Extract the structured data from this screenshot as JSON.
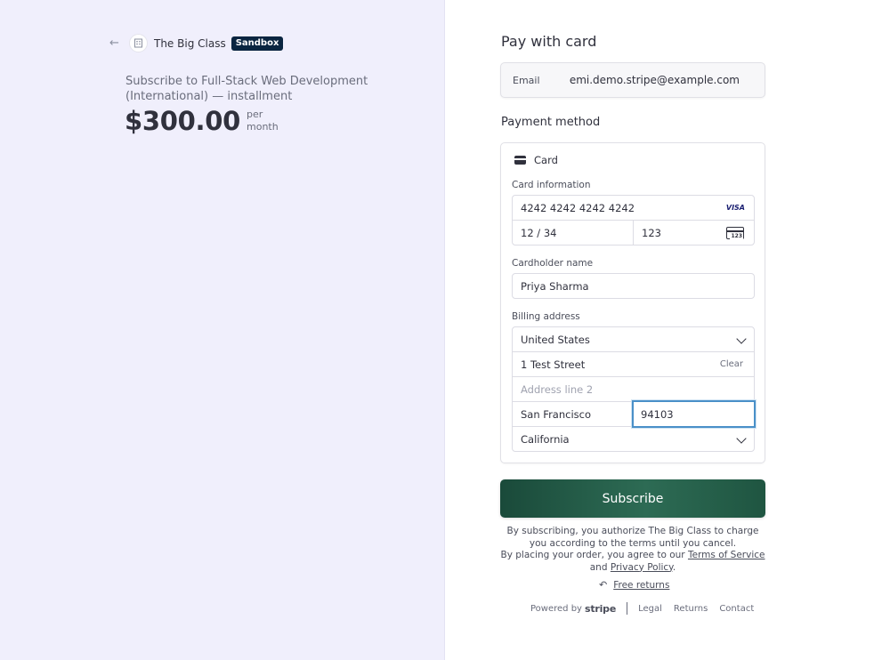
{
  "merchant": {
    "name": "The Big Class",
    "badge": "Sandbox"
  },
  "product": {
    "title": "Subscribe to Full-Stack Web Development (International) — installment",
    "price": "$300.00",
    "per": "per",
    "period": "month"
  },
  "checkout": {
    "heading": "Pay with card",
    "email_label": "Email",
    "email_value": "emi.demo.stripe@example.com",
    "payment_method_heading": "Payment method",
    "card_tab_label": "Card",
    "card_info_label": "Card information",
    "card_number": "4242 4242 4242 4242",
    "card_brand": "VISA",
    "expiry": "12 / 34",
    "cvc": "123",
    "cvc_icon_text": "123",
    "cardholder_label": "Cardholder name",
    "cardholder_name": "Priya Sharma",
    "billing_label": "Billing address",
    "country": "United States",
    "address_line1": "1 Test Street",
    "clear_label": "Clear",
    "address_line2_placeholder": "Address line 2",
    "city": "San Francisco",
    "zip": "94103",
    "state": "California",
    "subscribe_label": "Subscribe",
    "terms_line1": "By subscribing, you authorize The Big Class to charge you according to the terms until you cancel.",
    "terms_line2_prefix": "By placing your order, you agree to our",
    "terms_of_service": "Terms of Service",
    "terms_and": "and",
    "privacy_policy": "Privacy Policy",
    "terms_period": ".",
    "free_returns": "Free returns"
  },
  "footer": {
    "powered_by": "Powered by",
    "stripe": "stripe",
    "legal": "Legal",
    "returns": "Returns",
    "contact": "Contact"
  },
  "colors": {
    "left_background": "#f0effc",
    "subscribe_button": "#1f5541",
    "focus_border": "#4a90c8",
    "sandbox_badge": "#0a2540"
  }
}
